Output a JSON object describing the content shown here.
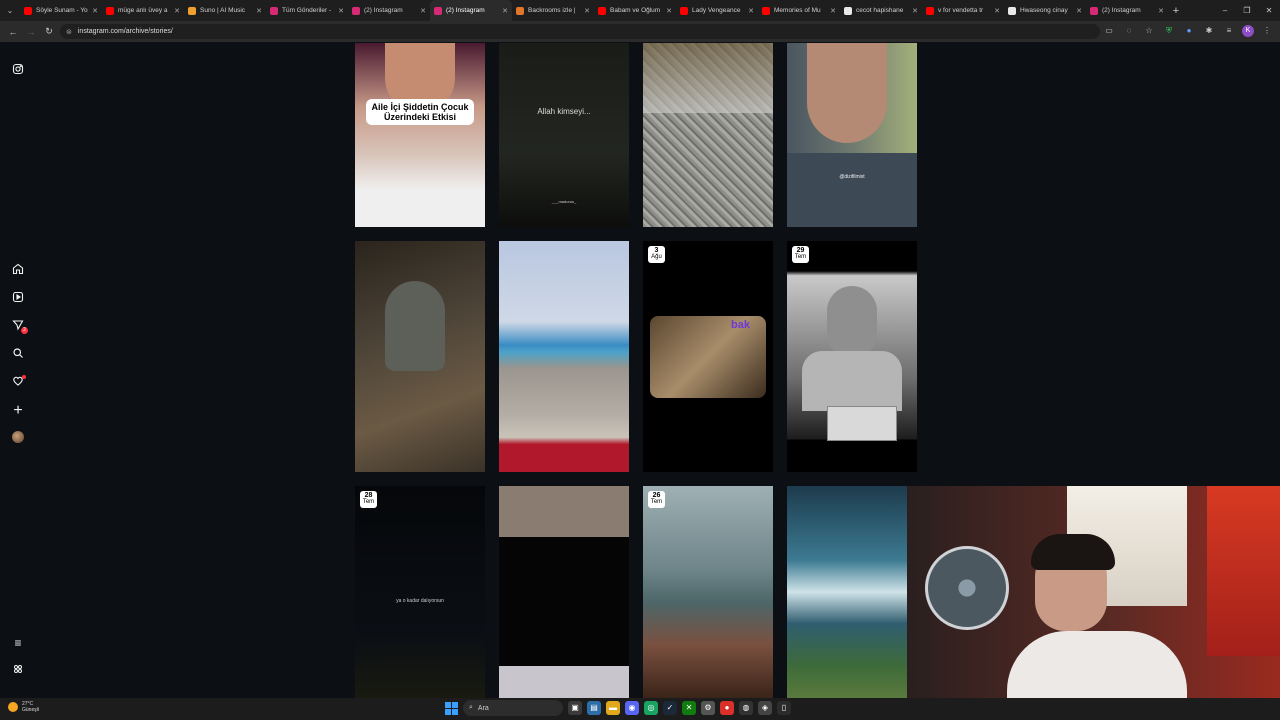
{
  "browser": {
    "tabs": [
      {
        "title": "Söyle Sunam - Yo",
        "favicon_color": "#ff0000"
      },
      {
        "title": "müge anlı üvey a",
        "favicon_color": "#ff0000"
      },
      {
        "title": "Suno | AI Music",
        "favicon_color": "#f0a030"
      },
      {
        "title": "Tüm Gönderiler -",
        "favicon_color": "#d62976"
      },
      {
        "title": "(2) Instagram",
        "favicon_color": "#d62976"
      },
      {
        "title": "(2) Instagram",
        "favicon_color": "#d62976",
        "active": true
      },
      {
        "title": "Backrooms izle |",
        "favicon_color": "#e0762a"
      },
      {
        "title": "Babam ve Oğlum",
        "favicon_color": "#ff0000"
      },
      {
        "title": "Lady Vengeance",
        "favicon_color": "#ff0000"
      },
      {
        "title": "Memories of Mu",
        "favicon_color": "#ff0000"
      },
      {
        "title": "cecot hapishane",
        "favicon_color": "#e8e8e8"
      },
      {
        "title": "v for vendetta tr",
        "favicon_color": "#ff0000"
      },
      {
        "title": "Hwaseong cinay",
        "favicon_color": "#e8e8e8"
      },
      {
        "title": "(2) Instagram",
        "favicon_color": "#d62976"
      }
    ],
    "url": "instagram.com/archive/stories/",
    "profile_letter": "K"
  },
  "stories": [
    {
      "row": 1,
      "caption": "Aile İçi Şiddetin Çocuk Üzerindeki Etkisi"
    },
    {
      "row": 1,
      "text": "Allah kimseyi...",
      "sub": "___madurus_"
    },
    {
      "row": 1
    },
    {
      "row": 1,
      "text": "@dizifilmist"
    },
    {
      "row": 2
    },
    {
      "row": 2
    },
    {
      "row": 2,
      "date_day": "3",
      "date_month": "Ağu",
      "text": "bak"
    },
    {
      "row": 2,
      "date_day": "29",
      "date_month": "Tem"
    },
    {
      "row": 3,
      "date_day": "28",
      "date_month": "Tem",
      "text": "ya o kadar dalıyorsun"
    },
    {
      "row": 3
    },
    {
      "row": 3,
      "date_day": "26",
      "date_month": "Tem"
    },
    {
      "row": 3
    }
  ],
  "taskbar": {
    "temperature": "27°C",
    "weather": "Güneşli",
    "search_label": "Ara"
  },
  "colors": {
    "background": "#0c1014",
    "notification": "#ff3040"
  }
}
